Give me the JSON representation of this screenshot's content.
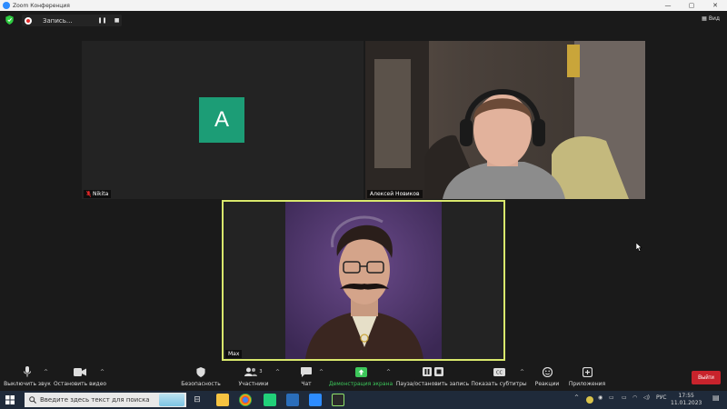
{
  "window": {
    "title": "Zoom Конференция"
  },
  "meeting_bar": {
    "recording_label": "Запись...",
    "view_label": "Вид"
  },
  "participants": [
    {
      "name": "Nikita",
      "avatar_letter": "A",
      "muted": true
    },
    {
      "name": "Алексей Новиков",
      "muted": false
    },
    {
      "name": "Max",
      "muted": false,
      "active_speaker": true
    }
  ],
  "toolbar": {
    "mute": "Выключить звук",
    "video": "Остановить видео",
    "security": "Безопасность",
    "participants": "Участники",
    "participants_count": "3",
    "chat": "Чат",
    "share": "Демонстрация экрана",
    "record": "Пауза/остановить запись",
    "captions": "Показать субтитры",
    "reactions": "Реакции",
    "apps": "Приложения",
    "leave": "Выйти"
  },
  "taskbar": {
    "search_placeholder": "Введите здесь текст для поиска",
    "language": "РУС",
    "time": "17:55",
    "date": "11.01.2023"
  },
  "colors": {
    "avatar_bg": "#1c9d76",
    "active_speaker_border": "#d9e86c",
    "leave_button": "#c8232c",
    "share_green": "#3cc75a"
  }
}
